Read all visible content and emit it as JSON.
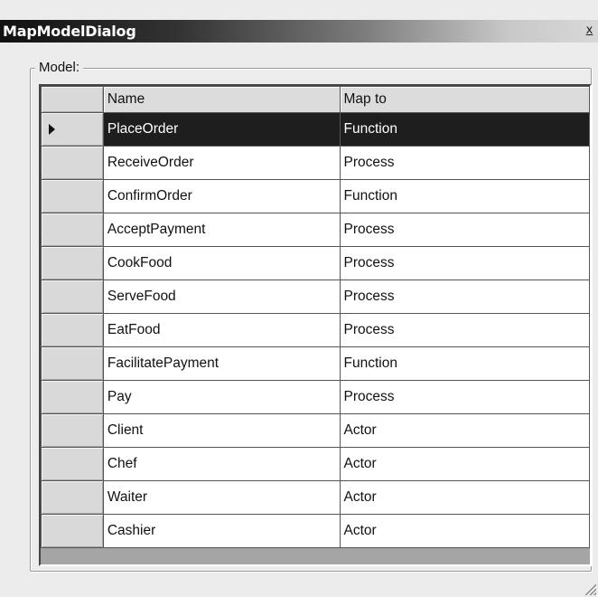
{
  "window": {
    "title": "MapModelDialog",
    "close_label": "x"
  },
  "group": {
    "label": "Model:"
  },
  "grid": {
    "columns": [
      "Name",
      "Map to"
    ],
    "selected_row": 0,
    "rows": [
      {
        "name": "PlaceOrder",
        "map_to": "Function"
      },
      {
        "name": "ReceiveOrder",
        "map_to": "Process"
      },
      {
        "name": "ConfirmOrder",
        "map_to": "Function"
      },
      {
        "name": "AcceptPayment",
        "map_to": "Process"
      },
      {
        "name": "CookFood",
        "map_to": "Process"
      },
      {
        "name": "ServeFood",
        "map_to": "Process"
      },
      {
        "name": "EatFood",
        "map_to": "Process"
      },
      {
        "name": "FacilitatePayment",
        "map_to": "Function"
      },
      {
        "name": "Pay",
        "map_to": "Process"
      },
      {
        "name": "Client",
        "map_to": "Actor"
      },
      {
        "name": "Chef",
        "map_to": "Actor"
      },
      {
        "name": "Waiter",
        "map_to": "Actor"
      },
      {
        "name": "Cashier",
        "map_to": "Actor"
      }
    ]
  }
}
